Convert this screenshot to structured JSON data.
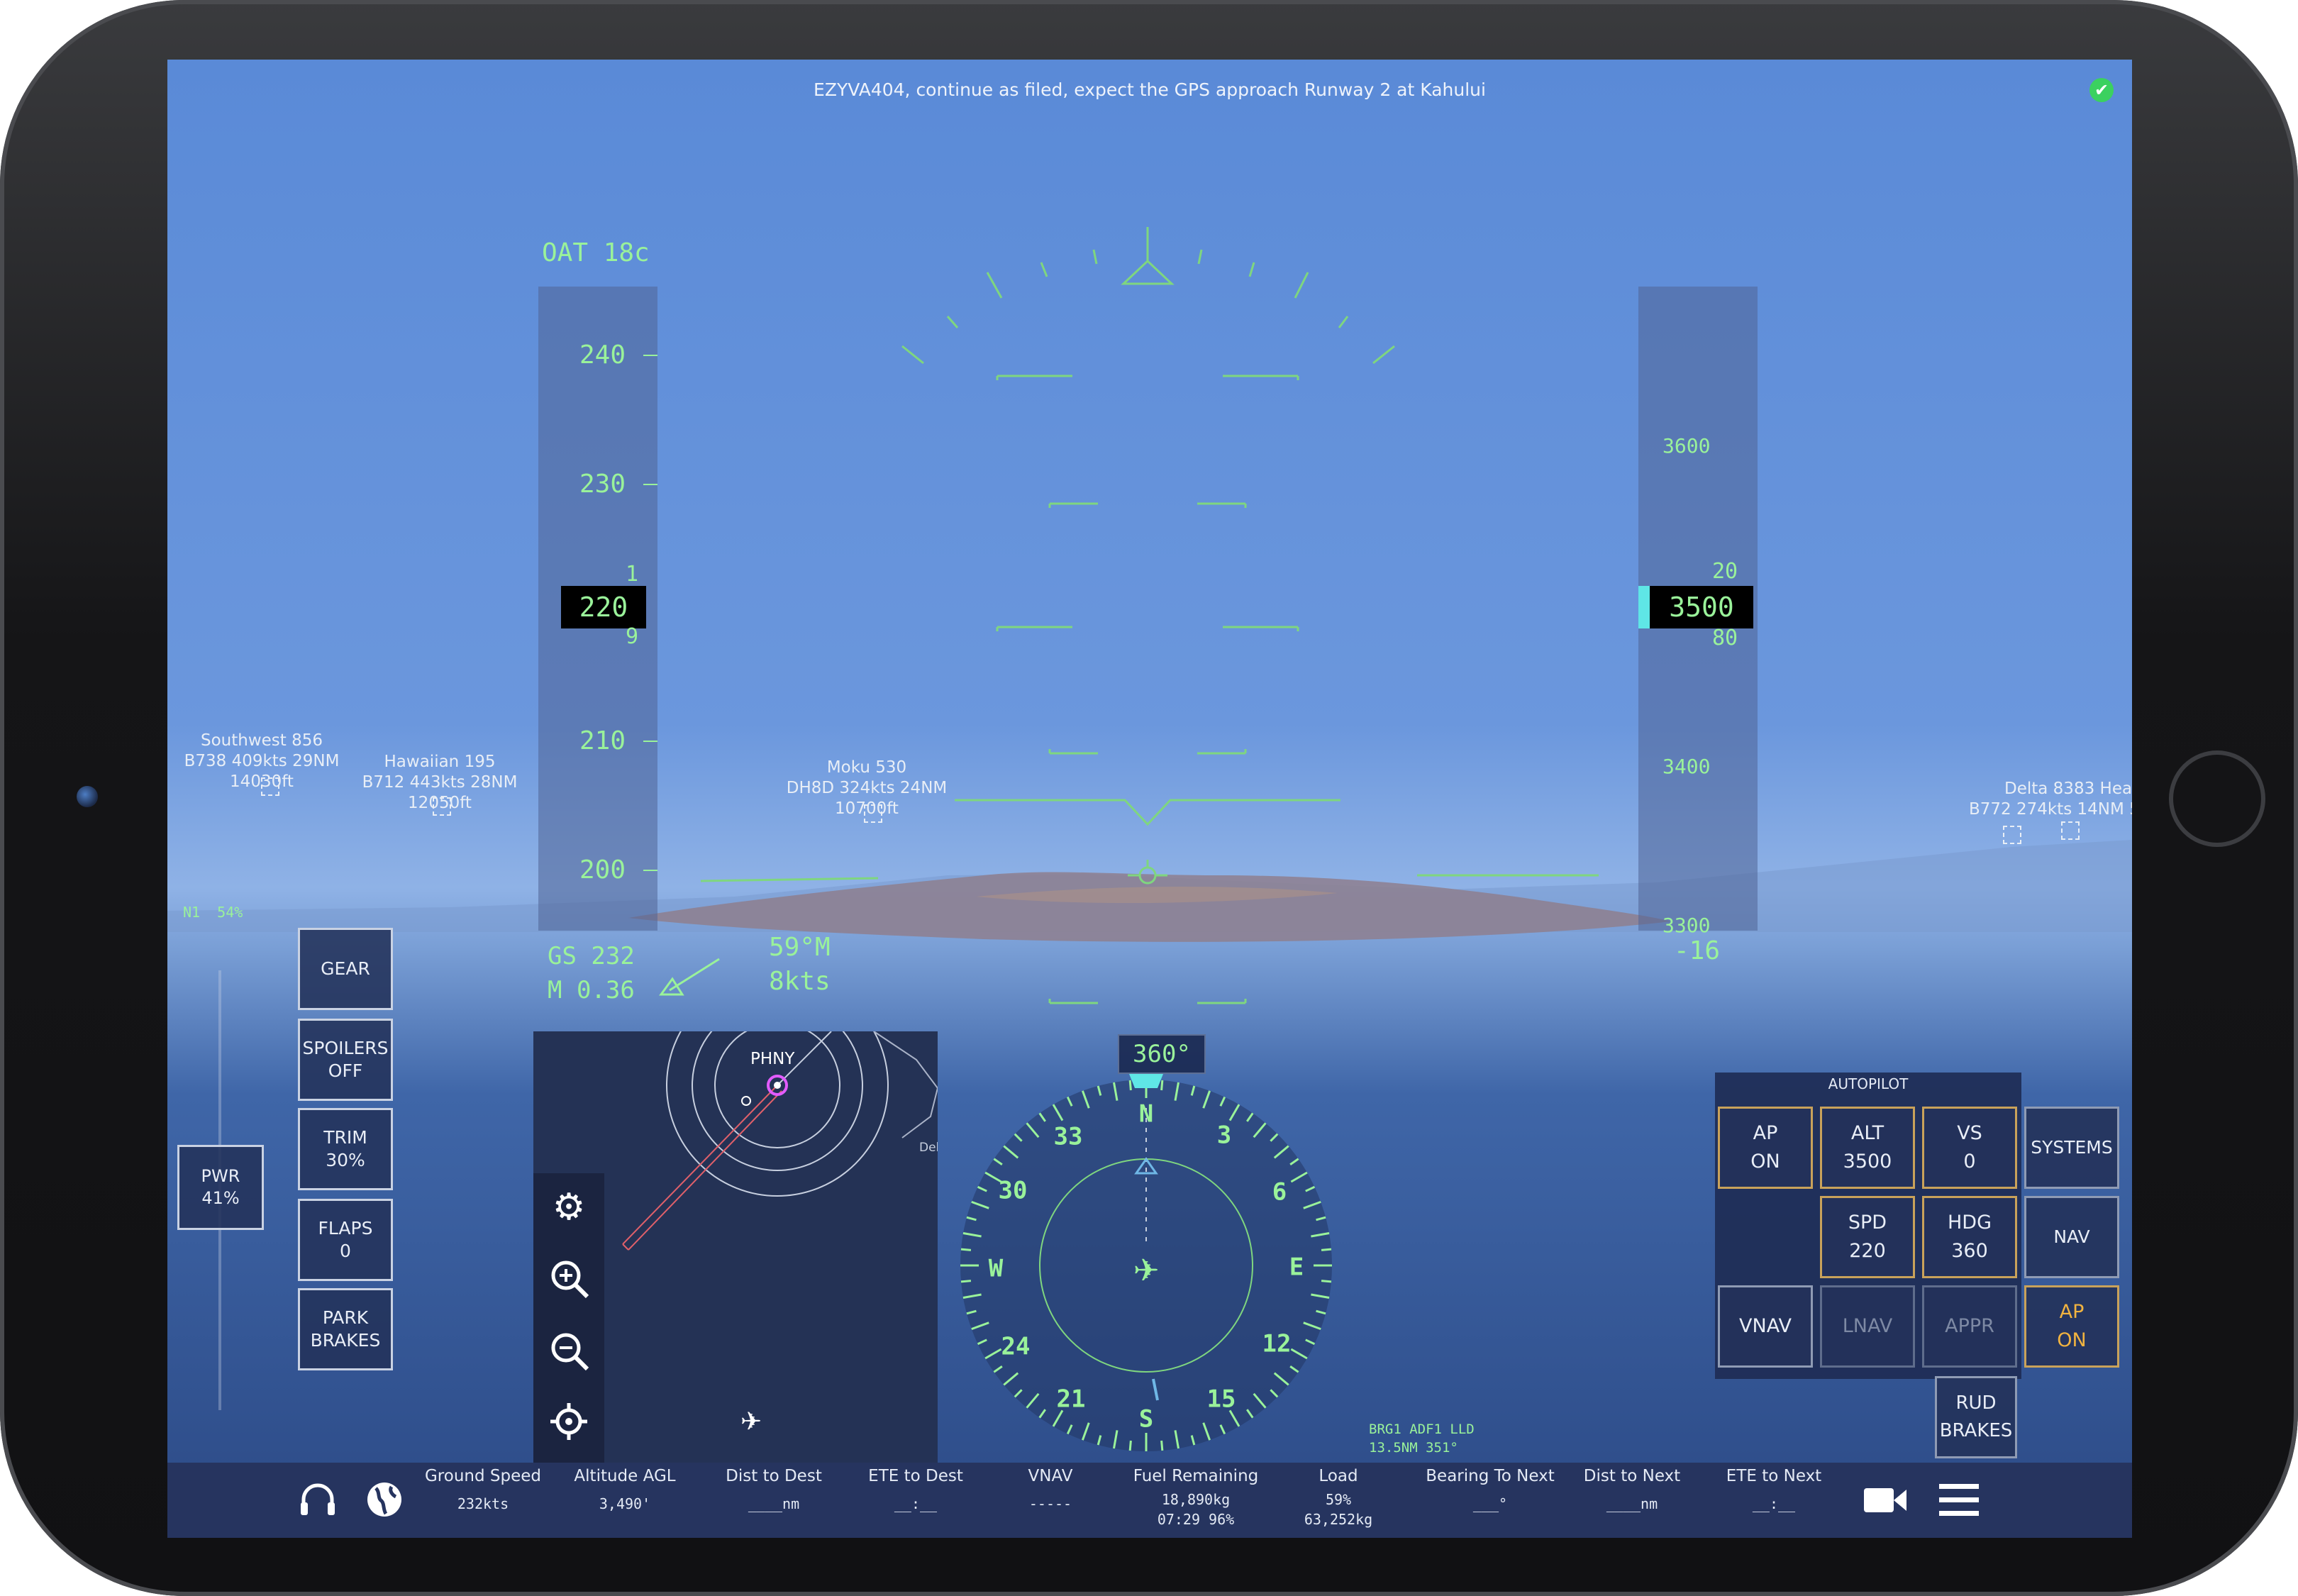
{
  "atc_message": "EZYVA404, continue as filed, expect the GPS approach Runway 2 at Kahului",
  "hud": {
    "oat": "OAT 18c",
    "speed_ticks": [
      "240",
      "230",
      "210",
      "200"
    ],
    "speed_current": "220",
    "speed_roll_above": "1",
    "speed_roll_below": "9",
    "altitude_ticks": [
      "3600",
      "3400",
      "3300"
    ],
    "altitude_current": "3500",
    "altitude_roll_above": "20",
    "altitude_roll_below": "80",
    "vertical_speed": "-16",
    "ground_speed": "GS 232",
    "mach": "M 0.36",
    "wind_direction": "59°M",
    "wind_speed": "8kts",
    "n1": "N1  54%",
    "heading_readout": "360°"
  },
  "traffic": [
    {
      "name": "Southwest 856",
      "info": "B738 409kts 29NM 14030ft"
    },
    {
      "name": "Hawaiian 195",
      "info": "B712 443kts 28NM 12050ft"
    },
    {
      "name": "Moku 530",
      "info": "DH8D 324kts 24NM 10700ft"
    },
    {
      "name": "Delta 8383 Heav",
      "info": "B772 274kts 14NM 5"
    }
  ],
  "left_controls": {
    "gear": "GEAR",
    "spoilers": [
      "SPOILERS",
      "OFF"
    ],
    "trim": [
      "TRIM",
      "30%"
    ],
    "flaps": [
      "FLAPS",
      "0"
    ],
    "park_brakes": [
      "PARK",
      "BRAKES"
    ],
    "power": [
      "PWR",
      "41%"
    ]
  },
  "map": {
    "airport": "PHNY",
    "edge_label": "Del"
  },
  "compass": {
    "labels": [
      "N",
      "3",
      "6",
      "E",
      "12",
      "15",
      "S",
      "21",
      "24",
      "W",
      "30",
      "33"
    ],
    "bearing_info": [
      "BRG1 ADF1 LLD",
      "13.5NM 351°"
    ]
  },
  "autopilot": {
    "title": "AUTOPILOT",
    "ap": [
      "AP",
      "ON"
    ],
    "alt": [
      "ALT",
      "3500"
    ],
    "vs": [
      "VS",
      "0"
    ],
    "spd": [
      "SPD",
      "220"
    ],
    "hdg": [
      "HDG",
      "360"
    ],
    "vnav": "VNAV",
    "lnav": "LNAV",
    "appr": "APPR",
    "ap_on": [
      "AP",
      "ON"
    ],
    "systems": "SYSTEMS",
    "nav": "NAV",
    "rud_brakes": [
      "RUD",
      "BRAKES"
    ]
  },
  "stats": [
    {
      "label": "Ground Speed",
      "value": "232kts"
    },
    {
      "label": "Altitude AGL",
      "value": "3,490'"
    },
    {
      "label": "Dist to Dest",
      "value": "____nm"
    },
    {
      "label": "ETE to Dest",
      "value": "__:__"
    },
    {
      "label": "VNAV",
      "value": "-----"
    },
    {
      "label": "Fuel Remaining",
      "value": "18,890kg",
      "value2": "07:29 96%"
    },
    {
      "label": "Load",
      "value": "59%",
      "value2": "63,252kg"
    },
    {
      "label": "Bearing To Next",
      "value": "___°"
    },
    {
      "label": "Dist to Next",
      "value": "____nm"
    },
    {
      "label": "ETE to Next",
      "value": "__:__"
    }
  ],
  "colors": {
    "hud_green": "#9af29a",
    "autopilot_amber": "#c9a25a",
    "ap_on_text": "#f1b340"
  }
}
